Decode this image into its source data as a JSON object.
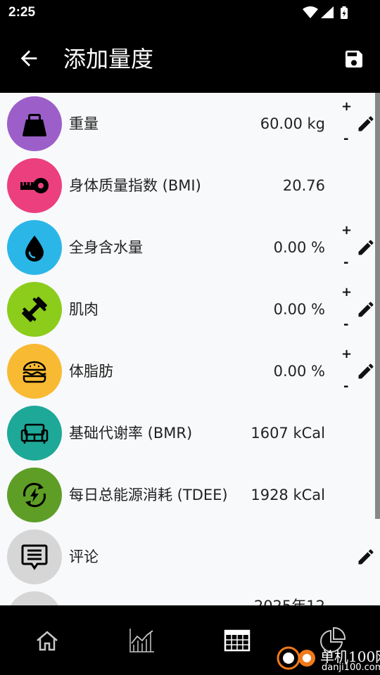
{
  "status_bar": {
    "time": "2:25"
  },
  "app_bar": {
    "title": "添加量度"
  },
  "colors": {
    "weight": "#9c5fc9",
    "bmi": "#ec3f7d",
    "water": "#2bb6e8",
    "muscle": "#8ccc1a",
    "fat": "#f9ba33",
    "bmr": "#1ea897",
    "tdee": "#5e9e26",
    "comment": "#d6d6d6"
  },
  "measurements": [
    {
      "icon": "kettlebell-icon",
      "label": "重量",
      "value": "60.00 kg",
      "plus": "+",
      "minus": "-"
    },
    {
      "icon": "tape-measure-icon",
      "label": "身体质量指数 (BMI)",
      "value": "20.76"
    },
    {
      "icon": "water-drop-icon",
      "label": "全身含水量",
      "value": "0.00 %",
      "plus": "+",
      "minus": "-"
    },
    {
      "icon": "dumbbell-icon",
      "label": "肌肉",
      "value": "0.00 %",
      "plus": "+",
      "minus": "-"
    },
    {
      "icon": "burger-icon",
      "label": "体脂肪",
      "value": "0.00 %",
      "plus": "+",
      "minus": "-"
    },
    {
      "icon": "sofa-icon",
      "label": "基础代谢率 (BMR)",
      "value": "1607 kCal"
    },
    {
      "icon": "energy-icon",
      "label": "每日总能源消耗 (TDEE)",
      "value": "1928 kCal"
    },
    {
      "icon": "comment-icon",
      "label": "评论",
      "value": ""
    },
    {
      "icon": "calendar-icon",
      "label": "",
      "value": "2025年12"
    }
  ],
  "bottom_nav": [
    "home-icon",
    "chart-icon",
    "table-icon",
    "pie-icon"
  ],
  "watermark": {
    "text": "单机100网",
    "url": "danji100.com"
  }
}
